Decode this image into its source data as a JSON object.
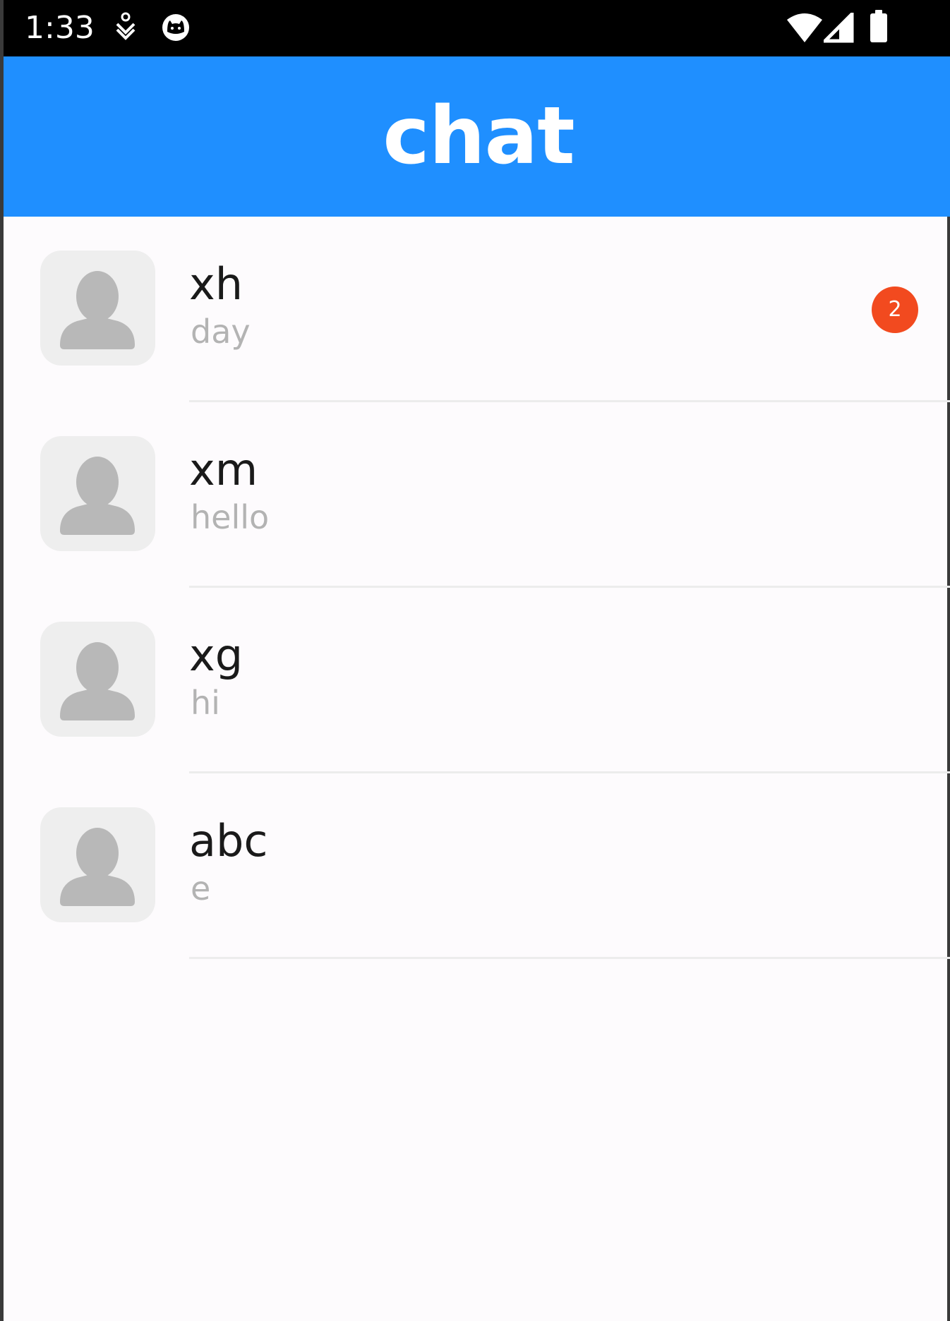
{
  "status_bar": {
    "time": "1:33",
    "left_icons": [
      "download-status-icon",
      "cat-face-icon"
    ],
    "right_icons": [
      "wifi-icon",
      "cellular-signal-icon",
      "battery-icon"
    ]
  },
  "app_bar": {
    "title": "chat",
    "color": "#1f8fff"
  },
  "chats": [
    {
      "name": "xh",
      "last_message": "day",
      "unread": "2"
    },
    {
      "name": "xm",
      "last_message": "hello",
      "unread": null
    },
    {
      "name": "xg",
      "last_message": "hi",
      "unread": null
    },
    {
      "name": "abc",
      "last_message": "e",
      "unread": null
    }
  ],
  "colors": {
    "badge": "#f24a1f",
    "background": "#fdfbfd",
    "avatar_placeholder": "#b8b8b8"
  }
}
